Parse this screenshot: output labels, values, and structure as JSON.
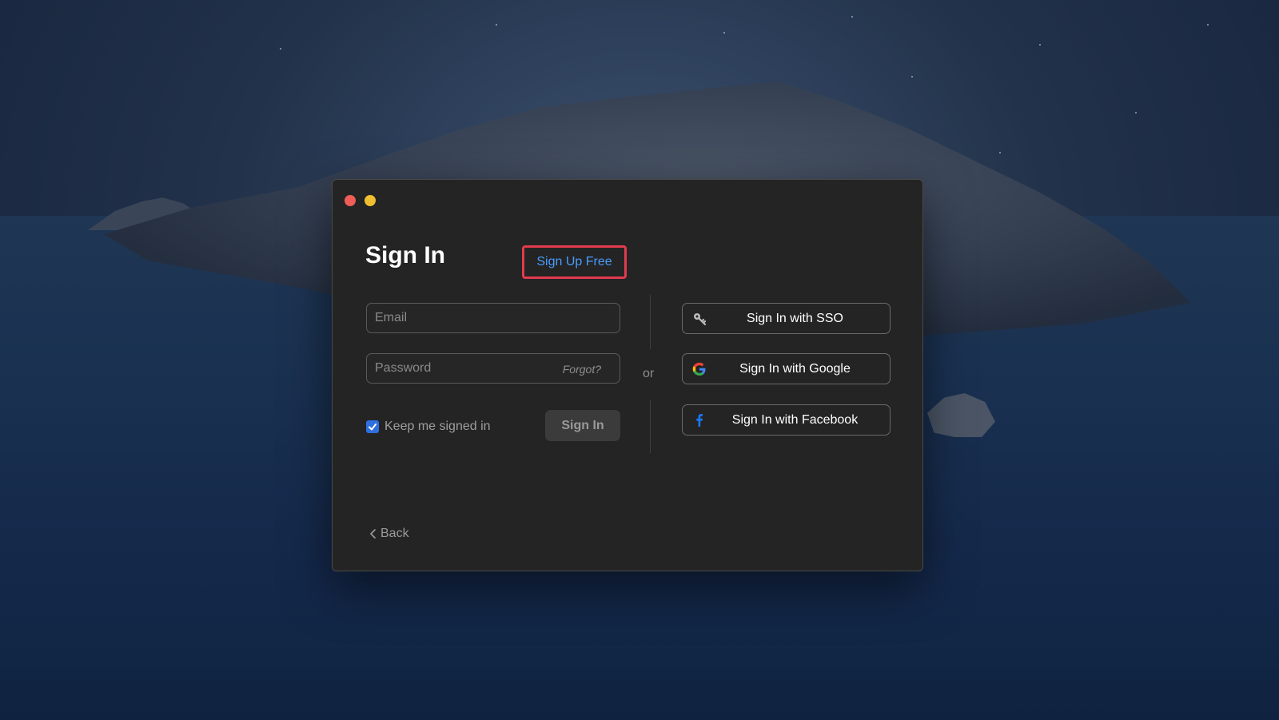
{
  "window": {
    "controls": {
      "close": "close-button",
      "minimize": "minimize-button"
    }
  },
  "header": {
    "title": "Sign In",
    "signup_label": "Sign Up Free"
  },
  "form": {
    "email_placeholder": "Email",
    "password_placeholder": "Password",
    "forgot_label": "Forgot?",
    "keep_signed_in_label": "Keep me signed in",
    "keep_signed_in_checked": true,
    "signin_label": "Sign In"
  },
  "divider": {
    "or_label": "or"
  },
  "social": {
    "sso_label": "Sign In with SSO",
    "google_label": "Sign In with Google",
    "facebook_label": "Sign In with Facebook"
  },
  "footer": {
    "back_label": "Back"
  },
  "colors": {
    "accent": "#4a9bff",
    "highlight": "#e23a4e",
    "window_bg": "#242424",
    "checkbox": "#2f6fe0"
  },
  "icons": {
    "sso": "key-icon",
    "google": "google-icon",
    "facebook": "facebook-icon",
    "back": "chevron-left-icon",
    "check": "checkmark-icon"
  }
}
